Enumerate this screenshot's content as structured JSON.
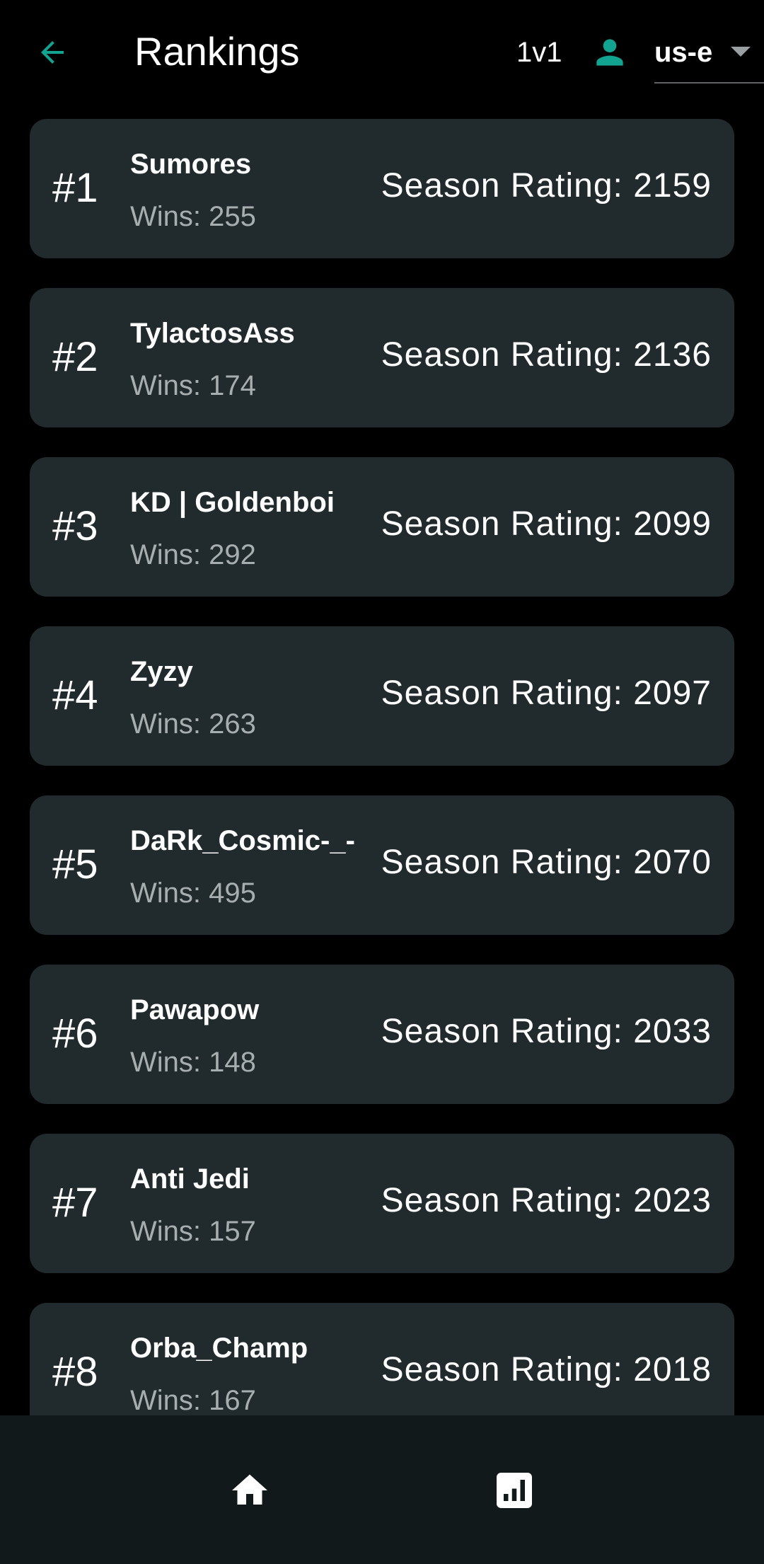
{
  "header": {
    "title": "Rankings",
    "mode": "1v1",
    "region": "us-e",
    "accent_color": "#13a391"
  },
  "rankings": [
    {
      "rank": "#1",
      "name": "Sumores",
      "wins": "Wins: 255",
      "rating": "Season Rating: 2159"
    },
    {
      "rank": "#2",
      "name": "TylactosAss",
      "wins": "Wins: 174",
      "rating": "Season Rating: 2136"
    },
    {
      "rank": "#3",
      "name": "KD | Goldenboi",
      "wins": "Wins: 292",
      "rating": "Season Rating: 2099"
    },
    {
      "rank": "#4",
      "name": "Zyzy",
      "wins": "Wins: 263",
      "rating": "Season Rating: 2097"
    },
    {
      "rank": "#5",
      "name": "DaRk_Cosmic-_-",
      "wins": "Wins: 495",
      "rating": "Season Rating: 2070"
    },
    {
      "rank": "#6",
      "name": "Pawapow",
      "wins": "Wins: 148",
      "rating": "Season Rating: 2033"
    },
    {
      "rank": "#7",
      "name": "Anti Jedi",
      "wins": "Wins: 157",
      "rating": "Season Rating: 2023"
    },
    {
      "rank": "#8",
      "name": "Orba_Champ",
      "wins": "Wins: 167",
      "rating": "Season Rating: 2018"
    }
  ],
  "bottom_nav": {
    "items": [
      {
        "icon": "home-icon"
      },
      {
        "icon": "leaderboard-icon"
      }
    ]
  }
}
